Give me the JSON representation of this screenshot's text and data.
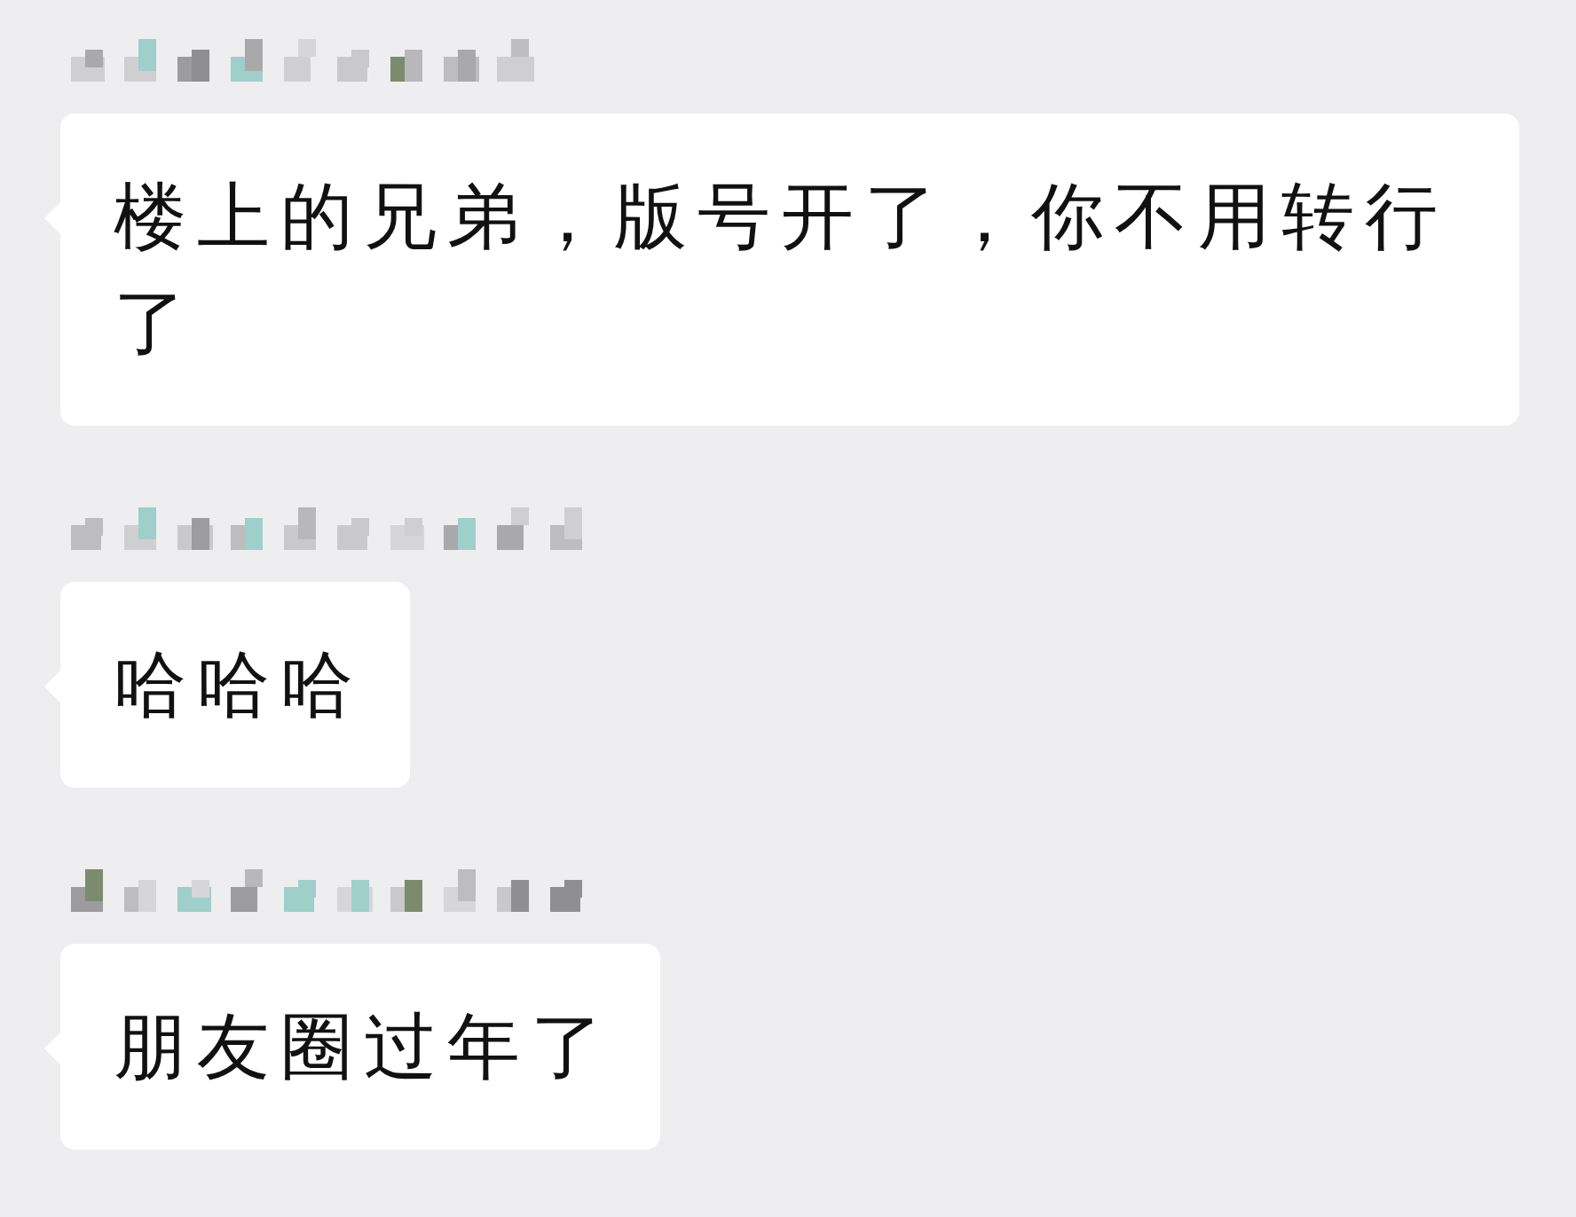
{
  "messages": [
    {
      "text": "楼上的兄弟，版号开了，你不用转行了"
    },
    {
      "text": "哈哈哈"
    },
    {
      "text": "朋友圈过年了"
    }
  ]
}
